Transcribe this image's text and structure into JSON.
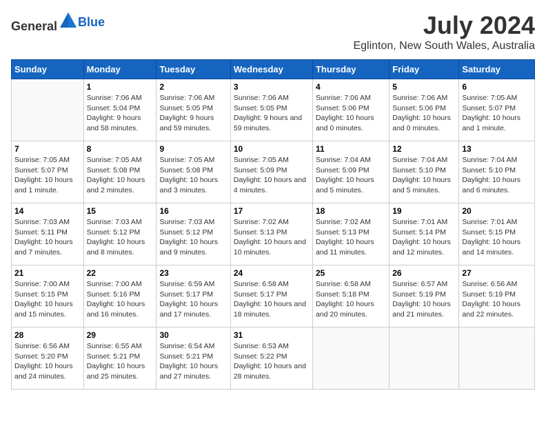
{
  "header": {
    "logo_general": "General",
    "logo_blue": "Blue",
    "month_year": "July 2024",
    "location": "Eglinton, New South Wales, Australia"
  },
  "days_of_week": [
    "Sunday",
    "Monday",
    "Tuesday",
    "Wednesday",
    "Thursday",
    "Friday",
    "Saturday"
  ],
  "weeks": [
    [
      {
        "day": "",
        "sunrise": "",
        "sunset": "",
        "daylight": ""
      },
      {
        "day": "1",
        "sunrise": "Sunrise: 7:06 AM",
        "sunset": "Sunset: 5:04 PM",
        "daylight": "Daylight: 9 hours and 58 minutes."
      },
      {
        "day": "2",
        "sunrise": "Sunrise: 7:06 AM",
        "sunset": "Sunset: 5:05 PM",
        "daylight": "Daylight: 9 hours and 59 minutes."
      },
      {
        "day": "3",
        "sunrise": "Sunrise: 7:06 AM",
        "sunset": "Sunset: 5:05 PM",
        "daylight": "Daylight: 9 hours and 59 minutes."
      },
      {
        "day": "4",
        "sunrise": "Sunrise: 7:06 AM",
        "sunset": "Sunset: 5:06 PM",
        "daylight": "Daylight: 10 hours and 0 minutes."
      },
      {
        "day": "5",
        "sunrise": "Sunrise: 7:06 AM",
        "sunset": "Sunset: 5:06 PM",
        "daylight": "Daylight: 10 hours and 0 minutes."
      },
      {
        "day": "6",
        "sunrise": "Sunrise: 7:05 AM",
        "sunset": "Sunset: 5:07 PM",
        "daylight": "Daylight: 10 hours and 1 minute."
      }
    ],
    [
      {
        "day": "7",
        "sunrise": "Sunrise: 7:05 AM",
        "sunset": "Sunset: 5:07 PM",
        "daylight": "Daylight: 10 hours and 1 minute."
      },
      {
        "day": "8",
        "sunrise": "Sunrise: 7:05 AM",
        "sunset": "Sunset: 5:08 PM",
        "daylight": "Daylight: 10 hours and 2 minutes."
      },
      {
        "day": "9",
        "sunrise": "Sunrise: 7:05 AM",
        "sunset": "Sunset: 5:08 PM",
        "daylight": "Daylight: 10 hours and 3 minutes."
      },
      {
        "day": "10",
        "sunrise": "Sunrise: 7:05 AM",
        "sunset": "Sunset: 5:09 PM",
        "daylight": "Daylight: 10 hours and 4 minutes."
      },
      {
        "day": "11",
        "sunrise": "Sunrise: 7:04 AM",
        "sunset": "Sunset: 5:09 PM",
        "daylight": "Daylight: 10 hours and 5 minutes."
      },
      {
        "day": "12",
        "sunrise": "Sunrise: 7:04 AM",
        "sunset": "Sunset: 5:10 PM",
        "daylight": "Daylight: 10 hours and 5 minutes."
      },
      {
        "day": "13",
        "sunrise": "Sunrise: 7:04 AM",
        "sunset": "Sunset: 5:10 PM",
        "daylight": "Daylight: 10 hours and 6 minutes."
      }
    ],
    [
      {
        "day": "14",
        "sunrise": "Sunrise: 7:03 AM",
        "sunset": "Sunset: 5:11 PM",
        "daylight": "Daylight: 10 hours and 7 minutes."
      },
      {
        "day": "15",
        "sunrise": "Sunrise: 7:03 AM",
        "sunset": "Sunset: 5:12 PM",
        "daylight": "Daylight: 10 hours and 8 minutes."
      },
      {
        "day": "16",
        "sunrise": "Sunrise: 7:03 AM",
        "sunset": "Sunset: 5:12 PM",
        "daylight": "Daylight: 10 hours and 9 minutes."
      },
      {
        "day": "17",
        "sunrise": "Sunrise: 7:02 AM",
        "sunset": "Sunset: 5:13 PM",
        "daylight": "Daylight: 10 hours and 10 minutes."
      },
      {
        "day": "18",
        "sunrise": "Sunrise: 7:02 AM",
        "sunset": "Sunset: 5:13 PM",
        "daylight": "Daylight: 10 hours and 11 minutes."
      },
      {
        "day": "19",
        "sunrise": "Sunrise: 7:01 AM",
        "sunset": "Sunset: 5:14 PM",
        "daylight": "Daylight: 10 hours and 12 minutes."
      },
      {
        "day": "20",
        "sunrise": "Sunrise: 7:01 AM",
        "sunset": "Sunset: 5:15 PM",
        "daylight": "Daylight: 10 hours and 14 minutes."
      }
    ],
    [
      {
        "day": "21",
        "sunrise": "Sunrise: 7:00 AM",
        "sunset": "Sunset: 5:15 PM",
        "daylight": "Daylight: 10 hours and 15 minutes."
      },
      {
        "day": "22",
        "sunrise": "Sunrise: 7:00 AM",
        "sunset": "Sunset: 5:16 PM",
        "daylight": "Daylight: 10 hours and 16 minutes."
      },
      {
        "day": "23",
        "sunrise": "Sunrise: 6:59 AM",
        "sunset": "Sunset: 5:17 PM",
        "daylight": "Daylight: 10 hours and 17 minutes."
      },
      {
        "day": "24",
        "sunrise": "Sunrise: 6:58 AM",
        "sunset": "Sunset: 5:17 PM",
        "daylight": "Daylight: 10 hours and 18 minutes."
      },
      {
        "day": "25",
        "sunrise": "Sunrise: 6:58 AM",
        "sunset": "Sunset: 5:18 PM",
        "daylight": "Daylight: 10 hours and 20 minutes."
      },
      {
        "day": "26",
        "sunrise": "Sunrise: 6:57 AM",
        "sunset": "Sunset: 5:19 PM",
        "daylight": "Daylight: 10 hours and 21 minutes."
      },
      {
        "day": "27",
        "sunrise": "Sunrise: 6:56 AM",
        "sunset": "Sunset: 5:19 PM",
        "daylight": "Daylight: 10 hours and 22 minutes."
      }
    ],
    [
      {
        "day": "28",
        "sunrise": "Sunrise: 6:56 AM",
        "sunset": "Sunset: 5:20 PM",
        "daylight": "Daylight: 10 hours and 24 minutes."
      },
      {
        "day": "29",
        "sunrise": "Sunrise: 6:55 AM",
        "sunset": "Sunset: 5:21 PM",
        "daylight": "Daylight: 10 hours and 25 minutes."
      },
      {
        "day": "30",
        "sunrise": "Sunrise: 6:54 AM",
        "sunset": "Sunset: 5:21 PM",
        "daylight": "Daylight: 10 hours and 27 minutes."
      },
      {
        "day": "31",
        "sunrise": "Sunrise: 6:53 AM",
        "sunset": "Sunset: 5:22 PM",
        "daylight": "Daylight: 10 hours and 28 minutes."
      },
      {
        "day": "",
        "sunrise": "",
        "sunset": "",
        "daylight": ""
      },
      {
        "day": "",
        "sunrise": "",
        "sunset": "",
        "daylight": ""
      },
      {
        "day": "",
        "sunrise": "",
        "sunset": "",
        "daylight": ""
      }
    ]
  ]
}
